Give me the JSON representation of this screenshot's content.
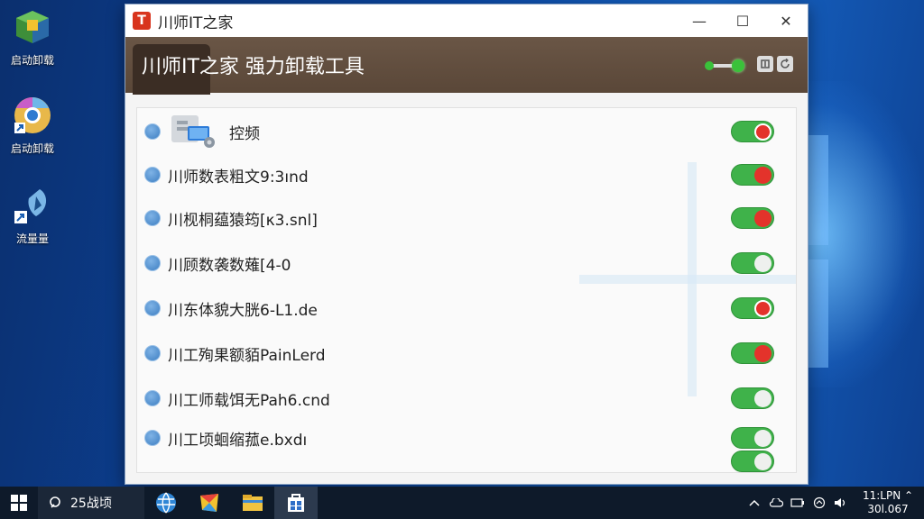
{
  "desktop": {
    "icons": [
      {
        "label": "启动卸载",
        "icon": "cube-box-icon"
      },
      {
        "label": "启动卸载",
        "icon": "chrome-browser-icon"
      },
      {
        "label": "流量量",
        "icon": "shield-shortcut-icon"
      }
    ]
  },
  "window": {
    "title": "川师IT之家",
    "logo_text": "T",
    "controls": {
      "minimize": "—",
      "maximize": "☐",
      "close": "✕"
    },
    "header_title": "川师IT之家 强力卸载工具"
  },
  "list": [
    {
      "label": "控频",
      "has_icon": true,
      "toggle": "on",
      "knob": "ring"
    },
    {
      "label": "川师数表粗文9:3ınd",
      "has_icon": false,
      "toggle": "on",
      "knob": "red"
    },
    {
      "label": "川枧桐蕴猿筠[κ3.snl]",
      "has_icon": false,
      "toggle": "on",
      "knob": "red"
    },
    {
      "label": "川顾数袭数薙[4-0",
      "has_icon": false,
      "toggle": "on",
      "knob": "white"
    },
    {
      "label": "川东体貌大胱6-L1.de",
      "has_icon": false,
      "toggle": "on",
      "knob": "ring"
    },
    {
      "label": "川工殉果额貊PainLerd",
      "has_icon": false,
      "toggle": "on",
      "knob": "red"
    },
    {
      "label": "川工师载饵无Pah6.cnd",
      "has_icon": false,
      "toggle": "on",
      "knob": "white"
    },
    {
      "label": "川工顷蛔缩菰e.bxdı",
      "has_icon": false,
      "toggle": "on",
      "knob": "white"
    }
  ],
  "taskbar": {
    "search_text": "25战顷",
    "clock_time": "11:LPN ⌃",
    "clock_date": "30l.067"
  },
  "colors": {
    "toggle_on": "#3fb24a",
    "knob_red": "#e3332b",
    "header_bg": "#6a5646",
    "desktop_bg": "#0c4aa8"
  }
}
